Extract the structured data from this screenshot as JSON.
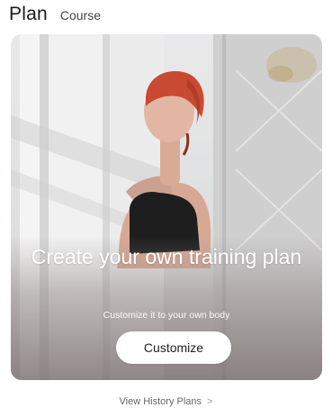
{
  "tabs": {
    "active_label": "Plan",
    "other_label": "Course"
  },
  "card": {
    "headline": "Create your own training plan",
    "subtext": "Customize it to your own body",
    "button_label": "Customize"
  },
  "footer": {
    "history_link": "View History Plans",
    "chevron": ">"
  },
  "colors": {
    "background": "#ffffff",
    "button_bg": "#ffffff",
    "hair": "#c94a32",
    "top": "#1f1f1f"
  },
  "icons": [
    "chevron-right-icon"
  ]
}
